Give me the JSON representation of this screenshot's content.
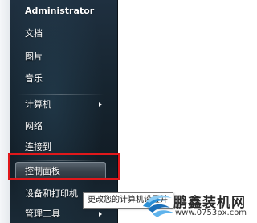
{
  "start_menu": {
    "items": [
      {
        "label": "Administrator",
        "has_submenu": false
      },
      {
        "label": "文档",
        "has_submenu": false
      },
      {
        "label": "图片",
        "has_submenu": false
      },
      {
        "label": "音乐",
        "has_submenu": false
      },
      {
        "label": "计算机",
        "has_submenu": true
      },
      {
        "label": "网络",
        "has_submenu": false
      },
      {
        "label": "连接到",
        "has_submenu": false
      },
      {
        "label": "控制面板",
        "has_submenu": false,
        "state": "hovered"
      },
      {
        "label": "设备和打印机",
        "has_submenu": false
      },
      {
        "label": "管理工具",
        "has_submenu": true
      }
    ]
  },
  "tooltip": {
    "text": "更改您的计算机设置并"
  },
  "watermark": {
    "title": "鹏鑫装机网",
    "url": "www.0753px.com"
  },
  "colors": {
    "highlight_box": "#e0181b",
    "menu_background": "#16242f",
    "text": "#ffffff"
  }
}
